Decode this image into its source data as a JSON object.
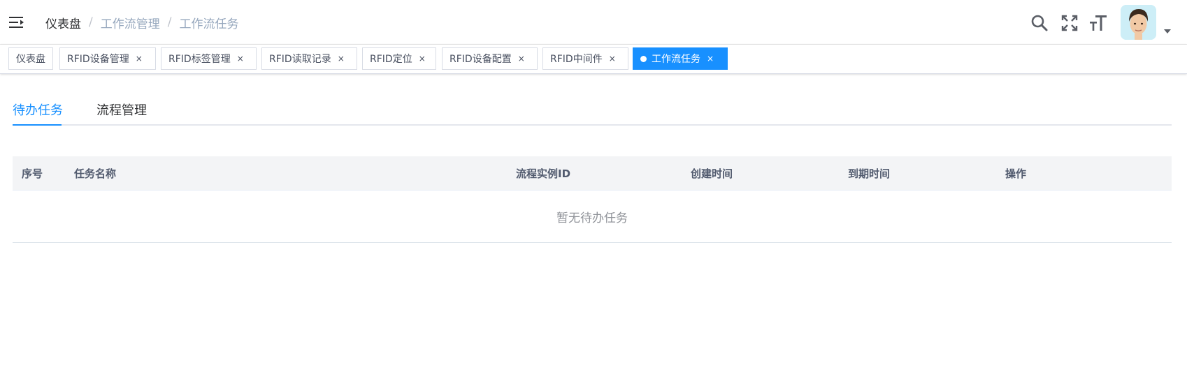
{
  "breadcrumb": {
    "items": [
      "仪表盘",
      "工作流管理",
      "工作流任务"
    ],
    "separator": "/"
  },
  "header": {
    "icons": [
      "search-icon",
      "fullscreen-icon",
      "font-size-icon",
      "avatar",
      "caret-down-icon"
    ]
  },
  "tags": [
    {
      "label": "仪表盘",
      "closable": false
    },
    {
      "label": "RFID设备管理",
      "closable": true
    },
    {
      "label": "RFID标签管理",
      "closable": true
    },
    {
      "label": "RFID读取记录",
      "closable": true
    },
    {
      "label": "RFID定位",
      "closable": true
    },
    {
      "label": "RFID设备配置",
      "closable": true
    },
    {
      "label": "RFID中间件",
      "closable": true
    },
    {
      "label": "工作流任务",
      "closable": true,
      "active": true
    }
  ],
  "tag_close_glyph": "×",
  "tabs": [
    {
      "label": "待办任务",
      "active": true
    },
    {
      "label": "流程管理",
      "active": false
    }
  ],
  "table": {
    "columns": [
      "序号",
      "任务名称",
      "流程实例ID",
      "创建时间",
      "到期时间",
      "操作"
    ],
    "rows": [],
    "empty_text": "暂无待办任务"
  },
  "colors": {
    "accent": "#1890ff",
    "header_bg": "#f3f4f6",
    "muted_text": "#97a8be"
  }
}
